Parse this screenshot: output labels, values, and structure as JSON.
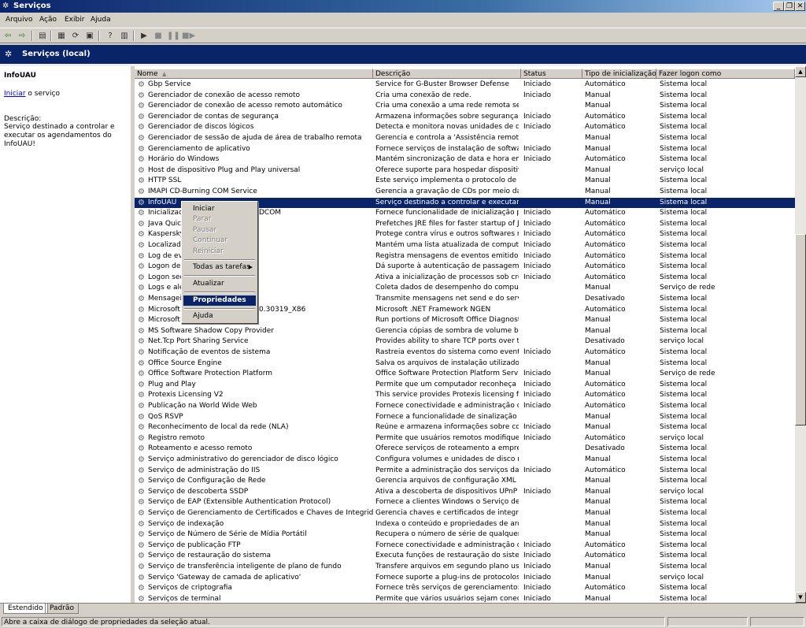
{
  "window": {
    "title": "Serviços"
  },
  "menu": [
    "Arquivo",
    "Ação",
    "Exibir",
    "Ajuda"
  ],
  "toolbar": {
    "buttons": [
      "back-icon",
      "forward-icon",
      "console-tree-icon",
      "properties-icon",
      "refresh-icon",
      "export-list-icon",
      "help-icon",
      "view-icon",
      "play-icon",
      "stop-icon",
      "pause-icon",
      "restart-icon"
    ]
  },
  "scope": {
    "title": "Serviços (local)"
  },
  "left_pane": {
    "title": "InfoUAU",
    "action_link": "Iniciar",
    "action_suffix": " o serviço",
    "desc_label": "Descrição:",
    "desc_text": "Serviço destinado a controlar e executar os agendamentos do InfoUAU!"
  },
  "table": {
    "columns": [
      "Nome",
      "Descrição",
      "Status",
      "Tipo de inicialização",
      "Fazer logon como"
    ],
    "selected_row": 11,
    "rows": [
      {
        "name": "Gbp Service",
        "desc": "Service for G-Buster Browser Defense",
        "status": "Iniciado",
        "start": "Automático",
        "logon": "Sistema local"
      },
      {
        "name": "Gerenciador de conexão de acesso remoto",
        "desc": "Cria uma conexão de rede.",
        "status": "Iniciado",
        "start": "Manual",
        "logon": "Sistema local"
      },
      {
        "name": "Gerenciador de conexão de acesso remoto automático",
        "desc": "Cria uma conexão a uma rede remota semp...",
        "status": "",
        "start": "Manual",
        "logon": "Sistema local"
      },
      {
        "name": "Gerenciador de contas de segurança",
        "desc": "Armazena informações sobre segurança par...",
        "status": "Iniciado",
        "start": "Automático",
        "logon": "Sistema local"
      },
      {
        "name": "Gerenciador de discos lógicos",
        "desc": "Detecta e monitora novas unidades de disc...",
        "status": "Iniciado",
        "start": "Automático",
        "logon": "Sistema local"
      },
      {
        "name": "Gerenciador de sessão de ajuda de área de trabalho remota",
        "desc": "Gerencia e controla a 'Assistência remota'. ...",
        "status": "",
        "start": "Manual",
        "logon": "Sistema local"
      },
      {
        "name": "Gerenciamento de aplicativo",
        "desc": "Fornece serviços de instalação de software ...",
        "status": "Iniciado",
        "start": "Manual",
        "logon": "Sistema local"
      },
      {
        "name": "Horário do Windows",
        "desc": "Mantém sincronização de data e hora em to...",
        "status": "Iniciado",
        "start": "Automático",
        "logon": "Sistema local"
      },
      {
        "name": "Host de dispositivo Plug and Play universal",
        "desc": "Oferece suporte para hospedar dispositivos...",
        "status": "",
        "start": "Manual",
        "logon": "serviço local"
      },
      {
        "name": "HTTP SSL",
        "desc": "Este serviço implementa o protocolo de tran...",
        "status": "",
        "start": "Manual",
        "logon": "Sistema local"
      },
      {
        "name": "IMAPI CD-Burning COM Service",
        "desc": "Gerencia a gravação de CDs por meio da int...",
        "status": "",
        "start": "Manual",
        "logon": "Sistema local"
      },
      {
        "name": "InfoUAU",
        "desc": "Serviço destinado a controlar e executar os...",
        "status": "",
        "start": "Manual",
        "logon": "Sistema local"
      },
      {
        "name": "Inicializado",
        "name_tail": "DCOM",
        "desc": "Fornece funcionalidade de inicialização para...",
        "status": "Iniciado",
        "start": "Automático",
        "logon": "Sistema local"
      },
      {
        "name": "Java Quick",
        "desc": "Prefetches JRE files for faster startup of Ja...",
        "status": "Iniciado",
        "start": "Automático",
        "logon": "Sistema local"
      },
      {
        "name": "Kaspersky",
        "desc": "Protege contra vírus e outros softwares mal...",
        "status": "Iniciado",
        "start": "Automático",
        "logon": "Sistema local"
      },
      {
        "name": "Localizador",
        "desc": "Mantém uma lista atualizada de computador...",
        "status": "Iniciado",
        "start": "Automático",
        "logon": "Sistema local"
      },
      {
        "name": "Log de eve",
        "desc": "Registra mensagens de eventos emitidos po...",
        "status": "Iniciado",
        "start": "Automático",
        "logon": "Sistema local"
      },
      {
        "name": "Logon de r",
        "desc": "Dá suporte à autenticação de passagem de ...",
        "status": "Iniciado",
        "start": "Automático",
        "logon": "Sistema local"
      },
      {
        "name": "Logon secu",
        "desc": "Ativa a inicialização de processos sob crede...",
        "status": "Iniciado",
        "start": "Automático",
        "logon": "Sistema local"
      },
      {
        "name": "Logs e aler",
        "desc": "Coleta dados de desempenho do computad...",
        "status": "",
        "start": "Manual",
        "logon": "Serviço de rede"
      },
      {
        "name": "Mensageiro",
        "desc": "Transmite mensagens net send e do serviço...",
        "status": "",
        "start": "Desativado",
        "logon": "Sistema local"
      },
      {
        "name": "Microsoft .",
        "name_tail": "0.30319_X86",
        "desc": "Microsoft .NET Framework NGEN",
        "status": "",
        "start": "Automático",
        "logon": "Sistema local"
      },
      {
        "name": "Microsoft C",
        "desc": "Run portions of Microsoft Office Diagnostics.",
        "status": "",
        "start": "Manual",
        "logon": "Sistema local"
      },
      {
        "name": "MS Software Shadow Copy Provider",
        "desc": "Gerencia cópias de sombra de volume base...",
        "status": "",
        "start": "Manual",
        "logon": "Sistema local"
      },
      {
        "name": "Net.Tcp Port Sharing Service",
        "desc": "Provides ability to share TCP ports over the...",
        "status": "",
        "start": "Desativado",
        "logon": "serviço local"
      },
      {
        "name": "Notificação de eventos de sistema",
        "desc": "Rastreia eventos do sistema como eventos ...",
        "status": "Iniciado",
        "start": "Automático",
        "logon": "Sistema local"
      },
      {
        "name": "Office  Source Engine",
        "desc": "Salva os arquivos de instalação utilizados e...",
        "status": "",
        "start": "Manual",
        "logon": "Sistema local"
      },
      {
        "name": "Office Software Protection Platform",
        "desc": "Office Software Protection Platform Service ...",
        "status": "Iniciado",
        "start": "Manual",
        "logon": "Serviço de rede"
      },
      {
        "name": "Plug and Play",
        "desc": "Permite que um computador reconheça e se...",
        "status": "Iniciado",
        "start": "Automático",
        "logon": "Sistema local"
      },
      {
        "name": "Protexis Licensing V2",
        "desc": "This service provides Protexis licensing func...",
        "status": "Iniciado",
        "start": "Automático",
        "logon": "Sistema local"
      },
      {
        "name": "Publicação na World Wide Web",
        "desc": "Fornece conectividade e administração da ...",
        "status": "Iniciado",
        "start": "Automático",
        "logon": "Sistema local"
      },
      {
        "name": "QoS RSVP",
        "desc": "Fornece a funcionalidade de sinalização de r...",
        "status": "",
        "start": "Manual",
        "logon": "Sistema local"
      },
      {
        "name": "Reconhecimento de local da rede (NLA)",
        "desc": "Reúne e armazena informações sobre confi...",
        "status": "Iniciado",
        "start": "Manual",
        "logon": "Sistema local"
      },
      {
        "name": "Registro remoto",
        "desc": "Permite que usuários remotos modifiquem c...",
        "status": "Iniciado",
        "start": "Automático",
        "logon": "serviço local"
      },
      {
        "name": "Roteamento e acesso remoto",
        "desc": "Oferece serviços de roteamento a empresa...",
        "status": "",
        "start": "Desativado",
        "logon": "Sistema local"
      },
      {
        "name": "Serviço administrativo do gerenciador de disco lógico",
        "desc": "Configura volumes e unidades de disco rígid...",
        "status": "",
        "start": "Manual",
        "logon": "Sistema local"
      },
      {
        "name": "Serviço de administração do IIS",
        "desc": "Permite a administração dos serviços da We...",
        "status": "Iniciado",
        "start": "Automático",
        "logon": "Sistema local"
      },
      {
        "name": "Serviço de Configuração de Rede",
        "desc": "Gerencia arquivos de configuração XML por ...",
        "status": "",
        "start": "Manual",
        "logon": "Sistema local"
      },
      {
        "name": "Serviço de descoberta SSDP",
        "desc": "Ativa a descoberta de dispositivos UPnP na ...",
        "status": "Iniciado",
        "start": "Manual",
        "logon": "serviço local"
      },
      {
        "name": "Serviço de EAP (Extensible Authentication Protocol)",
        "desc": "Fornece a clientes Windows o Serviço de EA...",
        "status": "",
        "start": "Manual",
        "logon": "Sistema local"
      },
      {
        "name": "Serviço de Gerenciamento de Certificados e Chaves de Integridade",
        "desc": "Gerencia chaves e certificados de integrida...",
        "status": "",
        "start": "Manual",
        "logon": "Sistema local"
      },
      {
        "name": "Serviço de indexação",
        "desc": "Indexa o conteúdo e propriedades de arqui...",
        "status": "",
        "start": "Manual",
        "logon": "Sistema local"
      },
      {
        "name": "Serviço de Número de Série de Mídia Portátil",
        "desc": "Recupera o número de série de qualquer pl...",
        "status": "",
        "start": "Manual",
        "logon": "Sistema local"
      },
      {
        "name": "Serviço de publicação FTP",
        "desc": "Fornece conectividade e administração do F...",
        "status": "Iniciado",
        "start": "Automático",
        "logon": "Sistema local"
      },
      {
        "name": "Serviço de restauração do sistema",
        "desc": "Executa funções de restauração do sistema...",
        "status": "Iniciado",
        "start": "Automático",
        "logon": "Sistema local"
      },
      {
        "name": "Serviço de transferência inteligente de plano de fundo",
        "desc": "Transfere arquivos em segundo plano usan...",
        "status": "Iniciado",
        "start": "Manual",
        "logon": "Sistema local"
      },
      {
        "name": "Serviço 'Gateway de camada de aplicativo'",
        "desc": "Fornece suporte a plug-ins de protocolos de...",
        "status": "Iniciado",
        "start": "Manual",
        "logon": "serviço local"
      },
      {
        "name": "Serviços de criptografia",
        "desc": "Fornece três serviços de gerenciamento: se...",
        "status": "Iniciado",
        "start": "Automático",
        "logon": "Sistema local"
      },
      {
        "name": "Serviços de terminal",
        "desc": "Permite que vários usuários sejam conectad...",
        "status": "Iniciado",
        "start": "Manual",
        "logon": "Sistema local"
      }
    ]
  },
  "context_menu": {
    "items": [
      {
        "label": "Iniciar",
        "enabled": true
      },
      {
        "label": "Parar",
        "enabled": false
      },
      {
        "label": "Pausar",
        "enabled": false
      },
      {
        "label": "Continuar",
        "enabled": false
      },
      {
        "label": "Reiniciar",
        "enabled": false
      },
      {
        "label": "Todas as tarefas",
        "enabled": true,
        "submenu": true
      },
      {
        "label": "Atualizar",
        "enabled": true
      },
      {
        "label": "Propriedades",
        "enabled": true,
        "highlighted": true
      },
      {
        "label": "Ajuda",
        "enabled": true
      }
    ]
  },
  "tabs": [
    "Estendido",
    "Padrão"
  ],
  "active_tab": "Estendido",
  "status": {
    "text": "Abre a caixa de diálogo de propriedades da seleção atual."
  }
}
